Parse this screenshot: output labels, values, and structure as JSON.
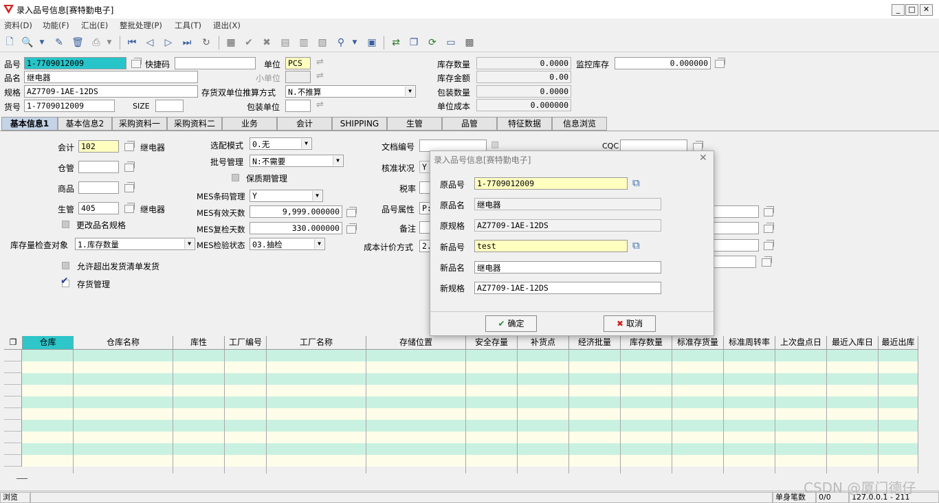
{
  "window": {
    "title": "录入品号信息[赛特勤电子]",
    "min": "_",
    "max": "□",
    "close": "✕"
  },
  "menu": [
    "资料(D)",
    "功能(F)",
    "汇出(E)",
    "整批处理(P)",
    "工具(T)",
    "退出(X)"
  ],
  "header": {
    "pinhao_label": "品号",
    "pinhao_value": "1-7709012009",
    "kuaijie_label": "快捷码",
    "kuaijie_value": "",
    "danwei_label": "单位",
    "danwei_value": "PCS",
    "pinming_label": "品名",
    "pinming_value": "继电器",
    "xiaodanwei_label": "小单位",
    "guige_label": "规格",
    "guige_value": "AZ7709-1AE-12DS",
    "shuangdanwei_label": "存货双单位推算方式",
    "shuangdanwei_value": "N.不推算",
    "huohao_label": "货号",
    "huohao_value": "1-7709012009",
    "size_label": "SIZE",
    "size_value": "",
    "baozhuang_label": "包装单位",
    "baozhuang_value": "",
    "kucunshuliang_label": "库存数量",
    "kucunshuliang_value": "0.0000",
    "kucunjine_label": "库存金额",
    "kucunjine_value": "0.00",
    "baozhuangshuliang_label": "包装数量",
    "baozhuangshuliang_value": "0.0000",
    "danweichengben_label": "单位成本",
    "danweichengben_value": "0.000000",
    "jiankong_label": "监控库存",
    "jiankong_value": "0.000000"
  },
  "tabs": [
    "基本信息1",
    "基本信息2",
    "采购资料一",
    "采购资料二",
    "业务",
    "会计",
    "SHIPPING",
    "生管",
    "品管",
    "特征数据",
    "信息浏览"
  ],
  "panel": {
    "kuaiji_label": "会计",
    "kuaiji_value": "102",
    "kuaiji_name": "继电器",
    "cangguan_label": "仓管",
    "cangguan_value": "",
    "shangpin_label": "商品",
    "shangpin_value": "",
    "shengguan_label": "生管",
    "shengguan_value": "405",
    "shengguan_name": "继电器",
    "genggai_label": "更改品名规格",
    "kucunjiancha_label": "库存量检查对象",
    "kucunjiancha_value": "1.库存数量",
    "yunxu_label": "允许超出发货清单发货",
    "cunhuo_label": "存货管理",
    "xuanpei_label": "选配模式",
    "xuanpei_value": "0.无",
    "pihao_label": "批号管理",
    "pihao_value": "N:不需要",
    "baozhiqi_label": "保质期管理",
    "mestiaoma_label": "MES条码管理",
    "mestiaoma_value": "Y",
    "mesyouxiao_label": "MES有效天数",
    "mesyouxiao_value": "9,999.000000",
    "mesfujian_label": "MES复检天数",
    "mesfujian_value": "330.000000",
    "mesjianyan_label": "MES检验状态",
    "mesjianyan_value": "03.抽检",
    "wendang_label": "文档编号",
    "wendang_value": "",
    "hezhun_label": "核准状况",
    "hezhun_value": "Y",
    "shuilv_label": "税率",
    "shuilv_value": "",
    "pinhaoshuxing_label": "品号属性",
    "pinhaoshuxing_value": "P:",
    "beizhu_label": "备注",
    "beizhu_value": "",
    "chengben_label": "成本计价方式",
    "chengben_value": "2.",
    "cqc_label": "CQC",
    "cqc_value": ""
  },
  "grid": {
    "columns": [
      "仓库",
      "仓库名称",
      "库性",
      "工厂编号",
      "工厂名称",
      "存储位置",
      "安全存量",
      "补货点",
      "经济批量",
      "库存数量",
      "标准存货量",
      "标准周转率",
      "上次盘点日",
      "最近入库日",
      "最近出库"
    ]
  },
  "status": {
    "mode": "浏览",
    "count_label": "单身笔数",
    "count_value": "0/0",
    "ip": "127.0.0.1 - 211"
  },
  "dialog": {
    "title": "录入品号信息[赛特勤电子]",
    "yuanpinhao_label": "原品号",
    "yuanpinhao_value": "1-7709012009",
    "yuanpinming_label": "原品名",
    "yuanpinming_value": "继电器",
    "yuanguige_label": "原规格",
    "yuanguige_value": "AZ7709-1AE-12DS",
    "xinpinhao_label": "新品号",
    "xinpinhao_value": "test",
    "xinpinming_label": "新品名",
    "xinpinming_value": "继电器",
    "xinguige_label": "新规格",
    "xinguige_value": "AZ7709-1AE-12DS",
    "ok_label": "确定",
    "cancel_label": "取消"
  },
  "watermark": "CSDN @厦门德仔"
}
